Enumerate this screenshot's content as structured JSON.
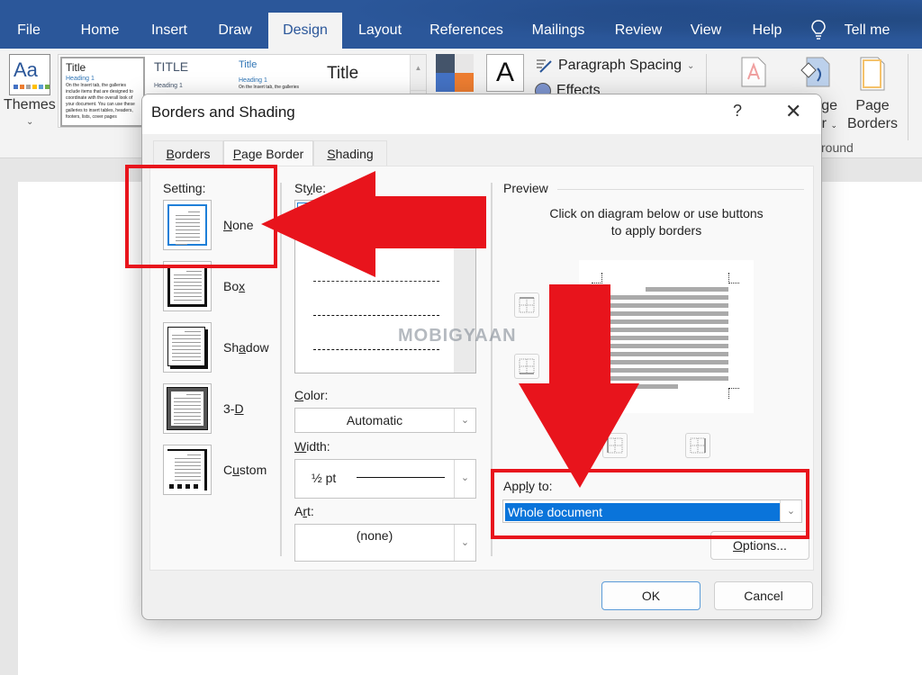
{
  "ribbon_tabs": [
    {
      "label": "File",
      "active": false
    },
    {
      "label": "Home",
      "active": false
    },
    {
      "label": "Insert",
      "active": false
    },
    {
      "label": "Draw",
      "active": false
    },
    {
      "label": "Design",
      "active": true
    },
    {
      "label": "Layout",
      "active": false
    },
    {
      "label": "References",
      "active": false
    },
    {
      "label": "Mailings",
      "active": false
    },
    {
      "label": "Review",
      "active": false
    },
    {
      "label": "View",
      "active": false
    },
    {
      "label": "Help",
      "active": false
    }
  ],
  "tell_me": {
    "icon": "lightbulb-icon",
    "label": "Tell me"
  },
  "ribbon": {
    "themes_label": "Themes",
    "themes_icon_text": "Aa",
    "theme_swatch_colors": [
      "#4472c4",
      "#ed7d31",
      "#a5a5a5",
      "#ffc000",
      "#5b9bd5",
      "#70ad47"
    ],
    "gallery": [
      {
        "title": "Title",
        "heading": "Heading 1",
        "body": "On the Insert tab, the galleries include items that are designed to coordinate with the overall look of your document. You can use these galleries to insert tables, headers, footers, lists, cover pages"
      },
      {
        "title": "TITLE",
        "heading": "Heading 1",
        "body": ""
      },
      {
        "title": "Title",
        "heading": "Heading 1",
        "body": "On the Insert tab, the galleries include items"
      },
      {
        "title": "Title",
        "heading": "",
        "body": ""
      }
    ],
    "colors_swatches": [
      "#44546a",
      "#e7e6e6",
      "#4472c4",
      "#ed7d31"
    ],
    "fonts_icon_text": "A",
    "paragraph_spacing_label": "Paragraph Spacing",
    "effects_label": "Effects",
    "page_color_label_partial": [
      "ge",
      "r"
    ],
    "page_borders_label": [
      "Page",
      "Borders"
    ],
    "group_label_partial": "round"
  },
  "dialog": {
    "title": "Borders and Shading",
    "help": "?",
    "close": "✕",
    "tabs": [
      {
        "label": "Borders",
        "accel": "B",
        "rest": "orders",
        "active": false
      },
      {
        "label": "Page Border",
        "accel": "P",
        "rest": "age Border",
        "active": true
      },
      {
        "label": "Shading",
        "accel": "S",
        "rest": "hading",
        "active": false
      }
    ],
    "setting_label": "Setting:",
    "settings": [
      {
        "name": "None",
        "pre": "",
        "accel": "N",
        "post": "one",
        "selected": true
      },
      {
        "name": "Box",
        "pre": "Bo",
        "accel": "x",
        "post": "",
        "selected": false
      },
      {
        "name": "Shadow",
        "pre": "Sh",
        "accel": "a",
        "post": "dow",
        "selected": false
      },
      {
        "name": "3-D",
        "pre": "3-",
        "accel": "D",
        "post": "",
        "selected": false
      },
      {
        "name": "Custom",
        "pre": "C",
        "accel": "u",
        "post": "stom",
        "selected": false
      }
    ],
    "style_label": {
      "pre": "St",
      "accel": "y",
      "post": "le:"
    },
    "style_options": [
      "solid",
      "dotted",
      "fine-dashed",
      "dashed",
      "dash-dot"
    ],
    "color_label": {
      "pre": "",
      "accel": "C",
      "post": "olor:"
    },
    "color_value": "Automatic",
    "width_label": {
      "pre": "",
      "accel": "W",
      "post": "idth:"
    },
    "width_value": "½ pt",
    "art_label": {
      "pre": "A",
      "accel": "r",
      "post": "t:"
    },
    "art_value": "(none)",
    "preview_label": "Preview",
    "preview_hint": "Click on diagram below or use buttons to apply borders",
    "apply_to_label": {
      "pre": "App",
      "accel": "l",
      "post": "y to:"
    },
    "apply_to_value": "Whole document",
    "options_button": {
      "pre": "",
      "accel": "O",
      "post": "ptions..."
    },
    "ok_button": "OK",
    "cancel_button": "Cancel"
  },
  "watermark": "MOBIGYAAN",
  "annotation_color": "#e8141c"
}
